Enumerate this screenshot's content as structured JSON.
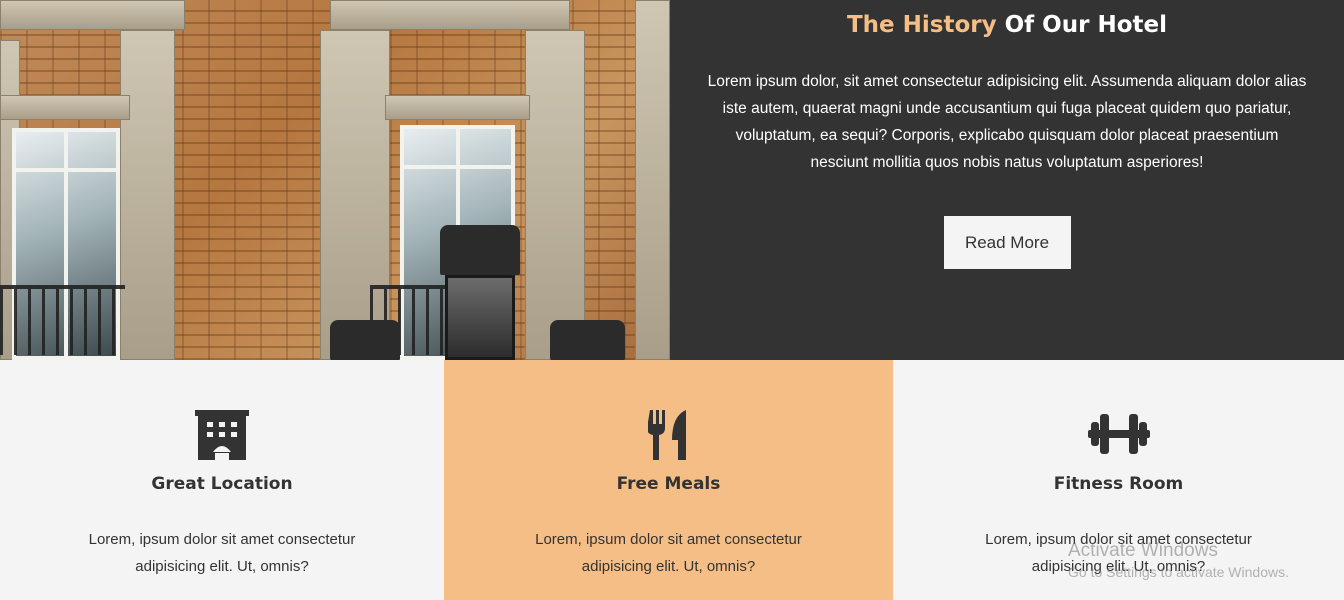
{
  "history": {
    "title_accent": "The History",
    "title_rest": " Of Our Hotel",
    "text": "Lorem ipsum dolor, sit amet consectetur adipisicing elit. Assumenda aliquam dolor alias iste autem, quaerat magni unde accusantium qui fuga placeat quidem quo pariatur, voluptatum, ea sequi? Corporis, explicabo quisquam dolor placeat praesentium nesciunt mollitia quos nobis natus voluptatum asperiores!",
    "button_label": "Read More"
  },
  "features": [
    {
      "icon": "building-icon",
      "title": "Great Location",
      "text": "Lorem, ipsum dolor sit amet consectetur adipisicing elit. Ut, omnis?"
    },
    {
      "icon": "utensils-icon",
      "title": "Free Meals",
      "text": "Lorem, ipsum dolor sit amet consectetur adipisicing elit. Ut, omnis?"
    },
    {
      "icon": "dumbbell-icon",
      "title": "Fitness Room",
      "text": "Lorem, ipsum dolor sit amet consectetur adipisicing elit. Ut, omnis?"
    }
  ],
  "watermark": {
    "title": "Activate Windows",
    "subtitle": "Go to Settings to activate Windows."
  },
  "colors": {
    "accent": "#f5be87",
    "dark": "#333333",
    "light": "#f4f4f4"
  }
}
